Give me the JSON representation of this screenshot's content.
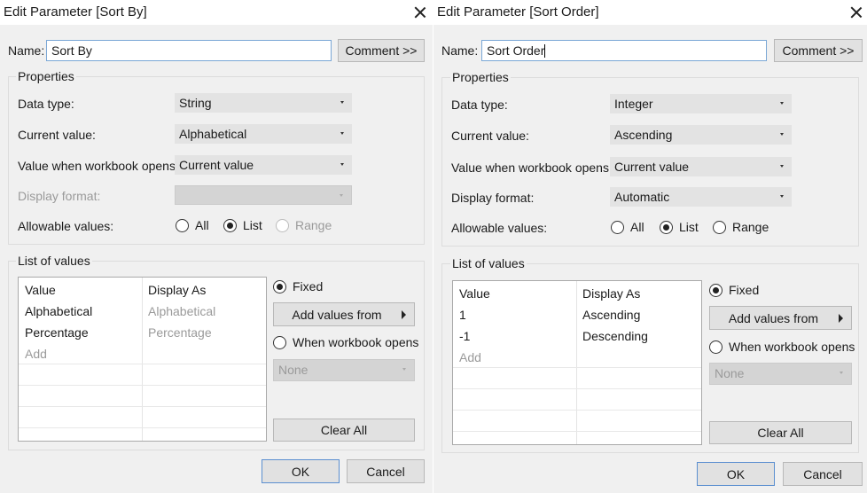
{
  "dialogs": [
    {
      "title": "Edit Parameter [Sort By]",
      "name_label": "Name:",
      "name_value": "Sort By",
      "comment_button": "Comment >>",
      "properties": {
        "title": "Properties",
        "data_type_label": "Data type:",
        "data_type_value": "String",
        "current_value_label": "Current value:",
        "current_value": "Alphabetical",
        "open_label": "Value when workbook opens:",
        "open_value": "Current value",
        "display_format_label": "Display format:",
        "display_format_value": "",
        "allowable_label": "Allowable values:",
        "opt_all": "All",
        "opt_list": "List",
        "opt_range": "Range"
      },
      "list": {
        "title": "List of values",
        "col_value": "Value",
        "col_display": "Display As",
        "rows": [
          {
            "value": "Alphabetical",
            "display": "Alphabetical"
          },
          {
            "value": "Percentage",
            "display": "Percentage"
          }
        ],
        "add": "Add",
        "fixed": "Fixed",
        "add_values_from": "Add values from",
        "when_opens": "When workbook opens",
        "none": "None",
        "clear_all": "Clear All"
      },
      "ok": "OK",
      "cancel": "Cancel"
    },
    {
      "title": "Edit Parameter [Sort Order]",
      "name_label": "Name:",
      "name_value": "Sort Order",
      "comment_button": "Comment >>",
      "properties": {
        "title": "Properties",
        "data_type_label": "Data type:",
        "data_type_value": "Integer",
        "current_value_label": "Current value:",
        "current_value": "Ascending",
        "open_label": "Value when workbook opens:",
        "open_value": "Current value",
        "display_format_label": "Display format:",
        "display_format_value": "Automatic",
        "allowable_label": "Allowable values:",
        "opt_all": "All",
        "opt_list": "List",
        "opt_range": "Range"
      },
      "list": {
        "title": "List of values",
        "col_value": "Value",
        "col_display": "Display As",
        "rows": [
          {
            "value": "1",
            "display": "Ascending"
          },
          {
            "value": "-1",
            "display": "Descending"
          }
        ],
        "add": "Add",
        "fixed": "Fixed",
        "add_values_from": "Add values from",
        "when_opens": "When workbook opens",
        "none": "None",
        "clear_all": "Clear All"
      },
      "ok": "OK",
      "cancel": "Cancel"
    }
  ]
}
